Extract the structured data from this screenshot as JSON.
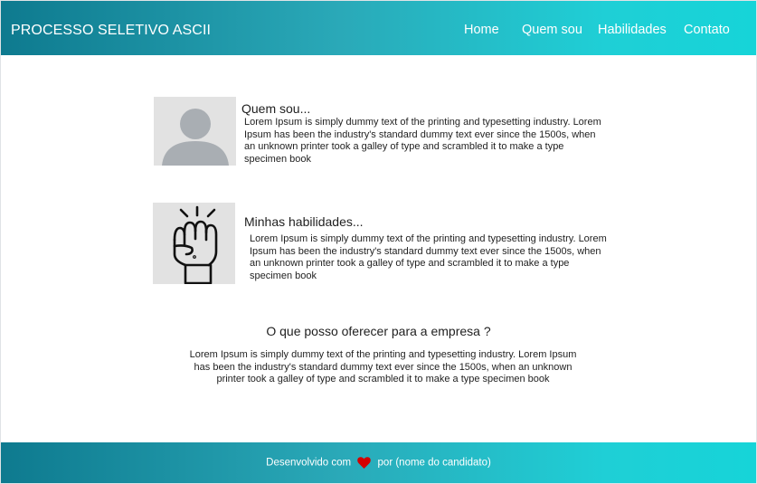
{
  "header": {
    "brand": "PROCESSO SELETIVO ASCII",
    "nav": [
      "Home",
      "Quem sou",
      "Habilidades",
      "Contato"
    ]
  },
  "sections": {
    "about": {
      "title": "Quem sou...",
      "text": "Lorem Ipsum is simply dummy text of the printing and typesetting industry. Lorem Ipsum has been the industry's standard dummy text ever since the 1500s, when an unknown printer took a galley of type and scrambled it to make a type specimen book",
      "image_icon": "user-avatar-icon"
    },
    "skills": {
      "title": "Minhas habilidades...",
      "text": "Lorem Ipsum is simply dummy text of the printing and typesetting industry. Lorem Ipsum has been the industry's standard dummy text ever since the 1500s, when an unknown printer took a galley of type and scrambled it to make a type specimen book",
      "image_icon": "raised-fist-icon"
    },
    "offer": {
      "title": "O que posso oferecer para a empresa ?",
      "text": "Lorem Ipsum is simply dummy text of the printing and typesetting industry. Lorem Ipsum has been the industry's standard dummy text ever since the 1500s, when an unknown printer took a galley of type and scrambled it to make a type specimen book"
    }
  },
  "footer": {
    "prefix": "Desenvolvido com",
    "suffix": "por (nome do candidato)",
    "heart_icon": "heart-icon"
  },
  "colors": {
    "gradient_start": "#0e7a8f",
    "gradient_end": "#16d4d8",
    "heart": "#d40000",
    "text": "#1f1f1f"
  }
}
